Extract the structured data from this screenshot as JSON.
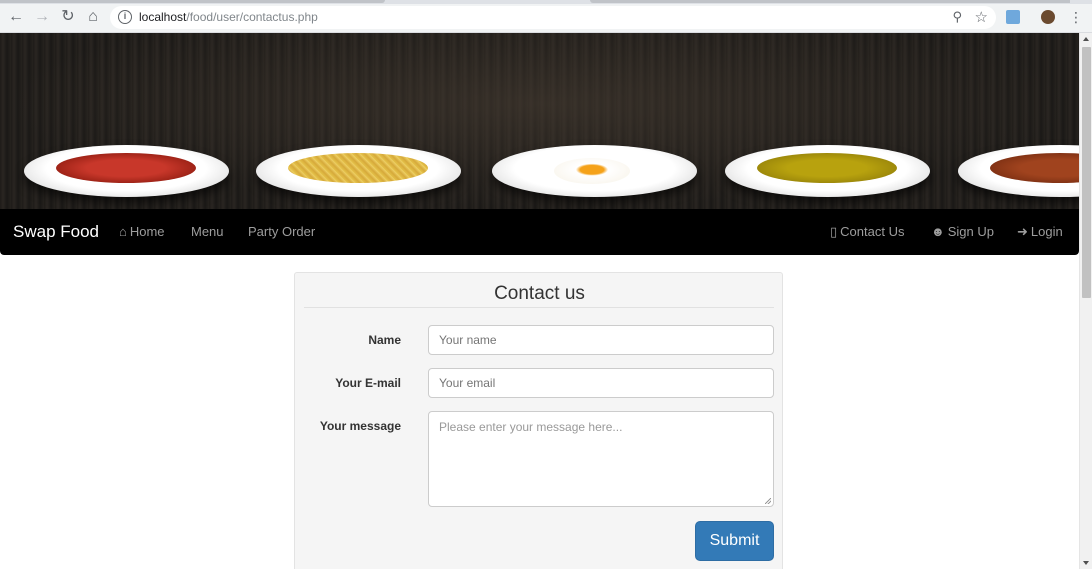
{
  "browser": {
    "url_host": "localhost",
    "url_path": "/food/user/contactus.php"
  },
  "navbar": {
    "brand": "Swap Food",
    "left_links": [
      {
        "label": "Home",
        "icon": "home-icon"
      },
      {
        "label": "Menu"
      },
      {
        "label": "Party Order"
      }
    ],
    "right_links": [
      {
        "label": "Contact Us",
        "icon": "phone-icon"
      },
      {
        "label": "Sign Up",
        "icon": "user-icon"
      },
      {
        "label": "Login",
        "icon": "login-icon"
      }
    ]
  },
  "contact_form": {
    "title": "Contact us",
    "name_label": "Name",
    "name_placeholder": "Your name",
    "email_label": "Your E-mail",
    "email_placeholder": "Your email",
    "message_label": "Your message",
    "message_placeholder": "Please enter your message here...",
    "submit_label": "Submit"
  },
  "colors": {
    "navbar_bg": "#000000",
    "nav_link": "#9d9d9d",
    "submit_bg": "#337ab7",
    "panel_bg": "#f5f5f5"
  }
}
